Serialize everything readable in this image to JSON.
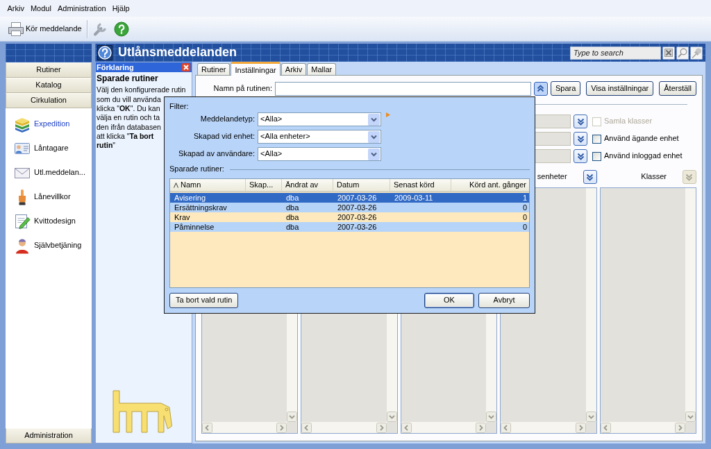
{
  "menu": [
    "Arkiv",
    "Modul",
    "Administration",
    "Hjälp"
  ],
  "toolbar": {
    "run_label": "Kör meddelande"
  },
  "sidebar": {
    "groups_top": [
      "Rutiner",
      "Katalog",
      "Cirkulation"
    ],
    "items": [
      {
        "label": "Expedition",
        "selected": true
      },
      {
        "label": "Låntagare",
        "selected": false
      },
      {
        "label": "Utl.meddelan...",
        "selected": false
      },
      {
        "label": "Lånevillkor",
        "selected": false
      },
      {
        "label": "Kvittodesign",
        "selected": false
      },
      {
        "label": "Självbetjäning",
        "selected": false
      }
    ],
    "groups_bottom": [
      "Administration"
    ]
  },
  "header": {
    "title": "Utlånsmeddelanden",
    "search": {
      "placeholder": "Type to search"
    }
  },
  "explanation": {
    "title": "Förklaring",
    "heading": "Sparade rutiner",
    "lines": [
      "Välj den konfigurerade rutin",
      "som du vill använda",
      "klicka \"**OK**\". Du kan",
      "välja en rutin och ta",
      "den ifrån databasen",
      "att klicka \"**Ta bort**",
      "**rutin**\""
    ]
  },
  "tabs": [
    {
      "label": "Rutiner",
      "selected": false
    },
    {
      "label": "Inställningar",
      "selected": true
    },
    {
      "label": "Arkiv",
      "selected": false
    },
    {
      "label": "Mallar",
      "selected": false
    }
  ],
  "settings": {
    "name_label": "Namn på rutinen:",
    "picker_expanded": true,
    "buttons": [
      "Spara",
      "Visa inställningar",
      "Återställ"
    ],
    "options": [
      {
        "field_disabled": true,
        "label": "Samla klasser",
        "checked": false,
        "disabled": true
      },
      {
        "field_disabled": true,
        "label": "Använd ägande enhet",
        "checked": false,
        "disabled": false
      },
      {
        "field_disabled": true,
        "label": "Använd inloggad enhet",
        "checked": false,
        "disabled": false
      }
    ],
    "list_headers": [
      {
        "label": "senheter",
        "button_disabled": false
      },
      {
        "label": "Klasser",
        "button_disabled": true
      }
    ]
  },
  "dialog": {
    "filter_label": "Filter:",
    "filters": [
      {
        "label": "Meddelandetyp:",
        "value": "<Alla>",
        "marked": true
      },
      {
        "label": "Skapad vid enhet:",
        "value": "<Alla enheter>",
        "marked": false
      },
      {
        "label": "Skapad av användare:",
        "value": "<Alla>",
        "marked": false
      }
    ],
    "saved_label": "Sparade rutiner:",
    "columns": [
      {
        "label": "Namn",
        "sorted": true,
        "kind": "text"
      },
      {
        "label": "Skap...",
        "sorted": false,
        "kind": "text"
      },
      {
        "label": "Ändrat av",
        "sorted": false,
        "kind": "text"
      },
      {
        "label": "Datum",
        "sorted": false,
        "kind": "text"
      },
      {
        "label": "Senast körd",
        "sorted": false,
        "kind": "text"
      },
      {
        "label": "Körd ant. gånger",
        "sorted": false,
        "kind": "count"
      }
    ],
    "rows": [
      {
        "name": "Avisering",
        "changed_by": "dba",
        "date": "2007-03-26",
        "last_run": "2009-03-11",
        "run_count": "1",
        "selected": true
      },
      {
        "name": "Ersättningskrav",
        "changed_by": "dba",
        "date": "2007-03-26",
        "run_count": "0",
        "selected": false
      },
      {
        "name": "Krav",
        "changed_by": "dba",
        "date": "2007-03-26",
        "run_count": "0",
        "selected": false
      },
      {
        "name": "Påminnelse",
        "changed_by": "dba",
        "date": "2007-03-26",
        "run_count": "0",
        "selected": false
      }
    ],
    "buttons": [
      {
        "label": "Ta bort vald rutin",
        "kind": "delete",
        "default": false
      },
      {
        "label": "OK",
        "kind": "ok",
        "default": true
      },
      {
        "label": "Avbryt",
        "kind": "cancel",
        "default": false
      }
    ]
  }
}
